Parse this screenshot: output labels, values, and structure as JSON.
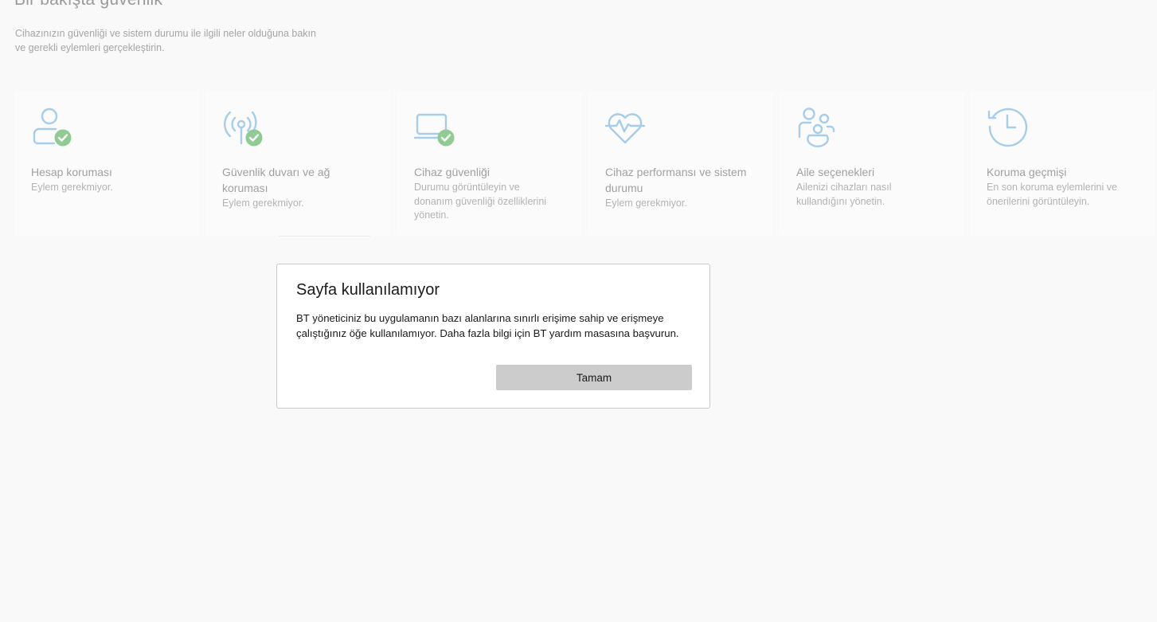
{
  "page": {
    "title": "Bir bakışta güvenlik",
    "subtitle": "Cihazınızın güvenliği ve sistem durumu ile ilgili neler olduğuna bakın ve gerekli eylemleri gerçekleştirin."
  },
  "cards": [
    {
      "title": "Hesap koruması",
      "description": "Eylem gerekmiyor.",
      "icon": "account-protection-icon",
      "status": "ok"
    },
    {
      "title": "Güvenlik duvarı ve ağ koruması",
      "description": "Eylem gerekmiyor.",
      "icon": "firewall-network-icon",
      "status": "ok"
    },
    {
      "title": "Cihaz güvenliği",
      "description": "Durumu görüntüleyin ve donanım güvenliği özelliklerini yönetin.",
      "icon": "device-security-icon",
      "status": "ok"
    },
    {
      "title": "Cihaz performansı ve sistem durumu",
      "description": "Eylem gerekmiyor.",
      "icon": "heart-pulse-icon",
      "status": "none"
    },
    {
      "title": "Aile seçenekleri",
      "description": "Ailenizi cihazları nasıl kullandığını yönetin.",
      "icon": "family-icon",
      "status": "none"
    },
    {
      "title": "Koruma geçmişi",
      "description": "En son koruma eylemlerini ve önerilerini görüntüleyin.",
      "icon": "history-icon",
      "status": "none"
    }
  ],
  "dialog": {
    "title": "Sayfa kullanılamıyor",
    "message": "BT yöneticiniz bu uygulamanın bazı alanlarına sınırlı erişime sahip ve erişmeye çalıştığınız öğe kullanılamıyor. Daha fazla bilgi için BT yardım masasına başvurun.",
    "ok_label": "Tamam"
  },
  "colors": {
    "icon_blue": "#a7cde8",
    "check_green": "#8fcb93",
    "background": "#f9f9f9",
    "button_gray": "#cccccc"
  }
}
